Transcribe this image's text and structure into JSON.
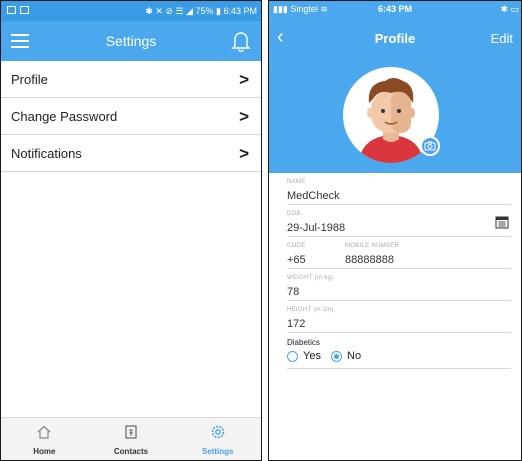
{
  "android": {
    "status": {
      "icons": "✱ ✕ ⊘ ☰ ◢",
      "battery": "75%",
      "time": "6:43 PM"
    },
    "appbar": {
      "title": "Settings"
    },
    "menu": [
      {
        "label": "Profile"
      },
      {
        "label": "Change Password"
      },
      {
        "label": "Notifications"
      }
    ],
    "tabs": [
      {
        "label": "Home",
        "icon": "home-icon"
      },
      {
        "label": "Contacts",
        "icon": "contacts-icon"
      },
      {
        "label": "Settings",
        "icon": "settings-icon",
        "active": true
      }
    ],
    "colors": {
      "primary": "#4ba8ee",
      "accent": "#4aa3e8"
    }
  },
  "ios": {
    "status": {
      "carrier": "Singtel",
      "time": "6:43 PM"
    },
    "nav": {
      "title": "Profile",
      "edit": "Edit"
    },
    "fields": {
      "name": {
        "label": "NAME",
        "value": "MedCheck"
      },
      "dob": {
        "label": "DOB",
        "value": "29-Jul-1988"
      },
      "code": {
        "label": "CODE",
        "value": "+65"
      },
      "mobile": {
        "label": "MOBILE NUMBER",
        "value": "88888888"
      },
      "weight": {
        "label": "WEIGHT (in kg)",
        "value": "78"
      },
      "height": {
        "label": "HEIGHT (in cm)",
        "value": "172"
      }
    },
    "diabetics": {
      "label": "Diabetics",
      "options": [
        "Yes",
        "No"
      ],
      "selected": "No"
    }
  }
}
